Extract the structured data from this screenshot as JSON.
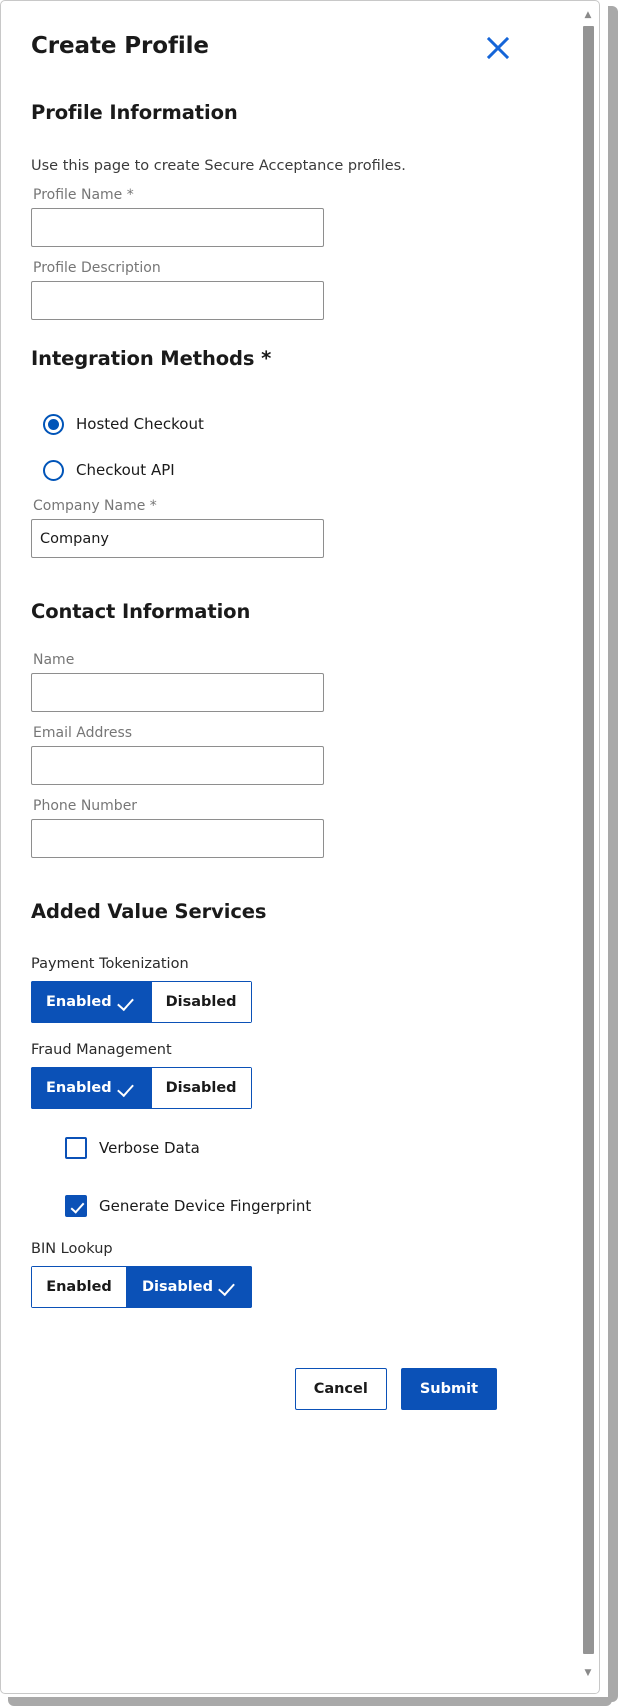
{
  "dialog": {
    "title": "Create Profile",
    "close_icon": "close-icon"
  },
  "profile_information": {
    "heading": "Profile Information",
    "helper_text": "Use this page to create Secure Acceptance profiles.",
    "fields": [
      {
        "label": "Profile Name *",
        "value": "",
        "placeholder": ""
      },
      {
        "label": "Profile Description",
        "value": "",
        "placeholder": ""
      }
    ]
  },
  "integration_methods": {
    "heading": "Integration Methods *",
    "options": [
      {
        "label": "Hosted Checkout",
        "selected": true
      },
      {
        "label": "Checkout API",
        "selected": false
      }
    ],
    "company_field": {
      "label": "Company Name *",
      "value": "Company",
      "placeholder": ""
    }
  },
  "contact_information": {
    "heading": "Contact Information",
    "fields": [
      {
        "label": "Name",
        "value": "",
        "placeholder": ""
      },
      {
        "label": "Email Address",
        "value": "",
        "placeholder": ""
      },
      {
        "label": "Phone Number",
        "value": "",
        "placeholder": ""
      }
    ]
  },
  "added_value_services": {
    "heading": "Added Value Services",
    "payment_tokenization": {
      "label": "Payment Tokenization",
      "enabled_label": "Enabled",
      "disabled_label": "Disabled",
      "selected": "Enabled"
    },
    "fraud_management": {
      "label": "Fraud Management",
      "enabled_label": "Enabled",
      "disabled_label": "Disabled",
      "selected": "Enabled"
    },
    "checkboxes": [
      {
        "label": "Verbose Data",
        "checked": false
      },
      {
        "label": "Generate Device Fingerprint",
        "checked": true
      }
    ],
    "bin_lookup": {
      "label": "BIN Lookup",
      "enabled_label": "Enabled",
      "disabled_label": "Disabled",
      "selected": "Disabled"
    }
  },
  "footer": {
    "cancel_label": "Cancel",
    "submit_label": "Submit"
  },
  "scrollbar": {
    "up_arrow_icon": "chevron-up-icon",
    "down_arrow_icon": "chevron-down-icon"
  },
  "colors": {
    "accent_blue": "#0b51b7",
    "radio_blue": "#0054b8",
    "label_gray": "#767676",
    "border_gray": "#8e8e8e"
  }
}
